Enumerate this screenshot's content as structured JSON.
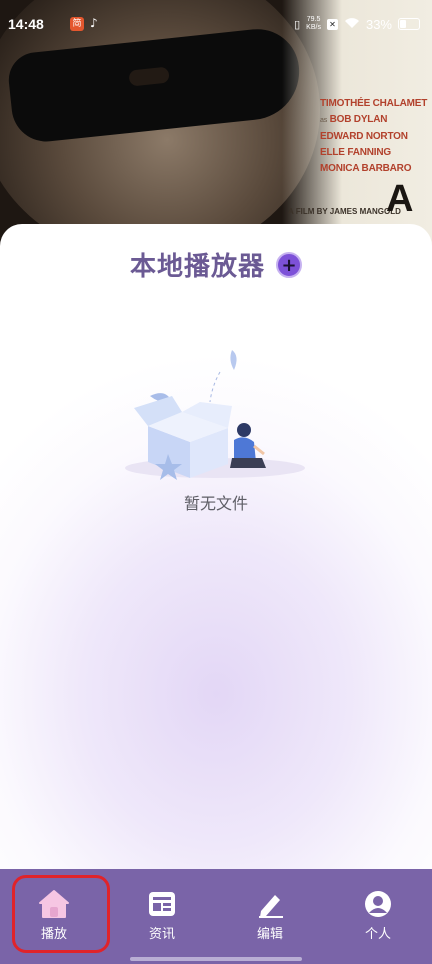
{
  "status_bar": {
    "time": "14:48",
    "speed_value": "79.5",
    "speed_unit": "KB/s",
    "battery": "33%"
  },
  "hero": {
    "credits": [
      "TIMOTHÉE CHALAMET",
      "BOB DYLAN",
      "EDWARD NORTON",
      "ELLE FANNING",
      "MONICA BARBARO"
    ],
    "credit_as": "as",
    "film_by": "A FILM BY JAMES MANGOLD",
    "letter": "A"
  },
  "main": {
    "title": "本地播放器",
    "add_label": "+",
    "empty_text": "暂无文件"
  },
  "nav": {
    "items": [
      {
        "label": "播放",
        "icon": "home-icon",
        "selected": true
      },
      {
        "label": "资讯",
        "icon": "news-icon"
      },
      {
        "label": "编辑",
        "icon": "edit-icon"
      },
      {
        "label": "个人",
        "icon": "profile-icon"
      }
    ]
  },
  "colors": {
    "accent": "#7d51d8",
    "nav_bg": "#7a64a8",
    "title": "#6b5a94",
    "highlight": "#e0232a"
  }
}
